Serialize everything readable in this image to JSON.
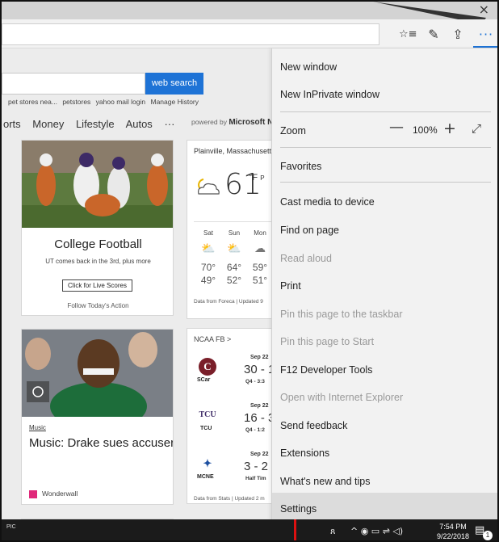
{
  "window": {
    "close_glyph": "×"
  },
  "toolbar": {
    "favorites_glyph": "☆≡",
    "notes_glyph": "✎",
    "share_glyph": "⇪",
    "more_glyph": "···"
  },
  "page": {
    "search_button": "web search",
    "history_items": [
      "pet stores nea...",
      "petstores",
      "yahoo mail login",
      "Manage History"
    ],
    "categories": [
      "orts",
      "Money",
      "Lifestyle",
      "Autos",
      "···"
    ],
    "powered_prefix": "powered by",
    "powered_brand": "Microsoft Ne",
    "football_card": {
      "title": "College Football",
      "subtitle": "UT comes back in the 3rd, plus more",
      "button": "Click for Live Scores",
      "follow": "Follow Today's Action"
    },
    "drake_card": {
      "category": "Music",
      "title": "Music: Drake sues accuser",
      "source": "Wonderwall"
    },
    "weather": {
      "location": "Plainville, Massachusett",
      "temp": "61",
      "unit": "°F",
      "unit_suffix": "P",
      "days": [
        {
          "day": "Sat",
          "icon": "partly-sunny-icon",
          "glyph": "⛅",
          "high": "70°",
          "low": "49°"
        },
        {
          "day": "Sun",
          "icon": "partly-sunny-icon",
          "glyph": "⛅",
          "high": "64°",
          "low": "52°"
        },
        {
          "day": "Mon",
          "icon": "cloud-icon",
          "glyph": "☁",
          "high": "59°",
          "low": "51°"
        }
      ],
      "data_note": "Data from Foreca | Updated 9"
    },
    "sports": {
      "header": "NCAA FB >",
      "games": [
        {
          "logo": "C",
          "abbr": "SCar",
          "date": "Sep 22",
          "score": "30 - 1",
          "status": "Q4 - 3:3"
        },
        {
          "logo": "TCU",
          "abbr": "TCU",
          "date": "Sep 22",
          "score": "16 - 3",
          "status": "Q4 - 1:2"
        },
        {
          "logo": "✦",
          "abbr": "MCNE",
          "date": "Sep 22",
          "score": "3 - 2",
          "status": "Half Tim"
        }
      ],
      "data_note": "Data from Stats | Updated 2 m"
    }
  },
  "menu": {
    "new_window": "New window",
    "new_inprivate": "New InPrivate window",
    "zoom_label": "Zoom",
    "zoom_minus": "—",
    "zoom_value": "100%",
    "zoom_plus": "+",
    "zoom_fullscreen": "⤢",
    "favorites": "Favorites",
    "cast": "Cast media to device",
    "find": "Find on page",
    "read_aloud": "Read aloud",
    "print": "Print",
    "pin_taskbar": "Pin this page to the taskbar",
    "pin_start": "Pin this page to Start",
    "f12": "F12 Developer Tools",
    "open_ie": "Open with Internet Explorer",
    "feedback": "Send feedback",
    "extensions": "Extensions",
    "whats_new": "What's new and tips",
    "settings": "Settings"
  },
  "taskbar": {
    "left_label_top": "PIC",
    "people_glyph": "ጸ",
    "tray_glyphs": "^  ◉  ▭  ⇌  ◁)",
    "time": "7:54 PM",
    "date": "9/22/2018",
    "notification_count": "1"
  },
  "colors": {
    "accent": "#1e73d6",
    "menu_bg": "#f2f2f2",
    "settings_hover": "#dcdcdc"
  }
}
